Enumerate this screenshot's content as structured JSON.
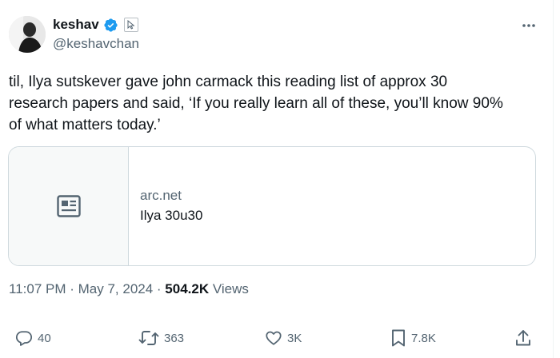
{
  "author": {
    "display_name": "keshav",
    "handle": "@keshavchan",
    "verified": true
  },
  "tweet": {
    "text": "til, Ilya sutskever gave john carmack this reading list of approx 30\nresearch papers and said, ‘If you really learn all of these, you’ll know 90%\nof what matters today.’"
  },
  "card": {
    "domain": "arc.net",
    "title": "Ilya 30u30",
    "thumb_icon": "article-icon"
  },
  "meta": {
    "time": "11:07 PM",
    "separator": " · ",
    "date": "May 7, 2024",
    "views_count": "504.2K",
    "views_label": "Views"
  },
  "actions": {
    "replies": "40",
    "reposts": "363",
    "likes": "3K",
    "bookmarks": "7.8K"
  },
  "colors": {
    "text": "#0f1419",
    "secondary": "#536471",
    "border": "#cfd9de",
    "verified_blue": "#1d9bf0"
  }
}
